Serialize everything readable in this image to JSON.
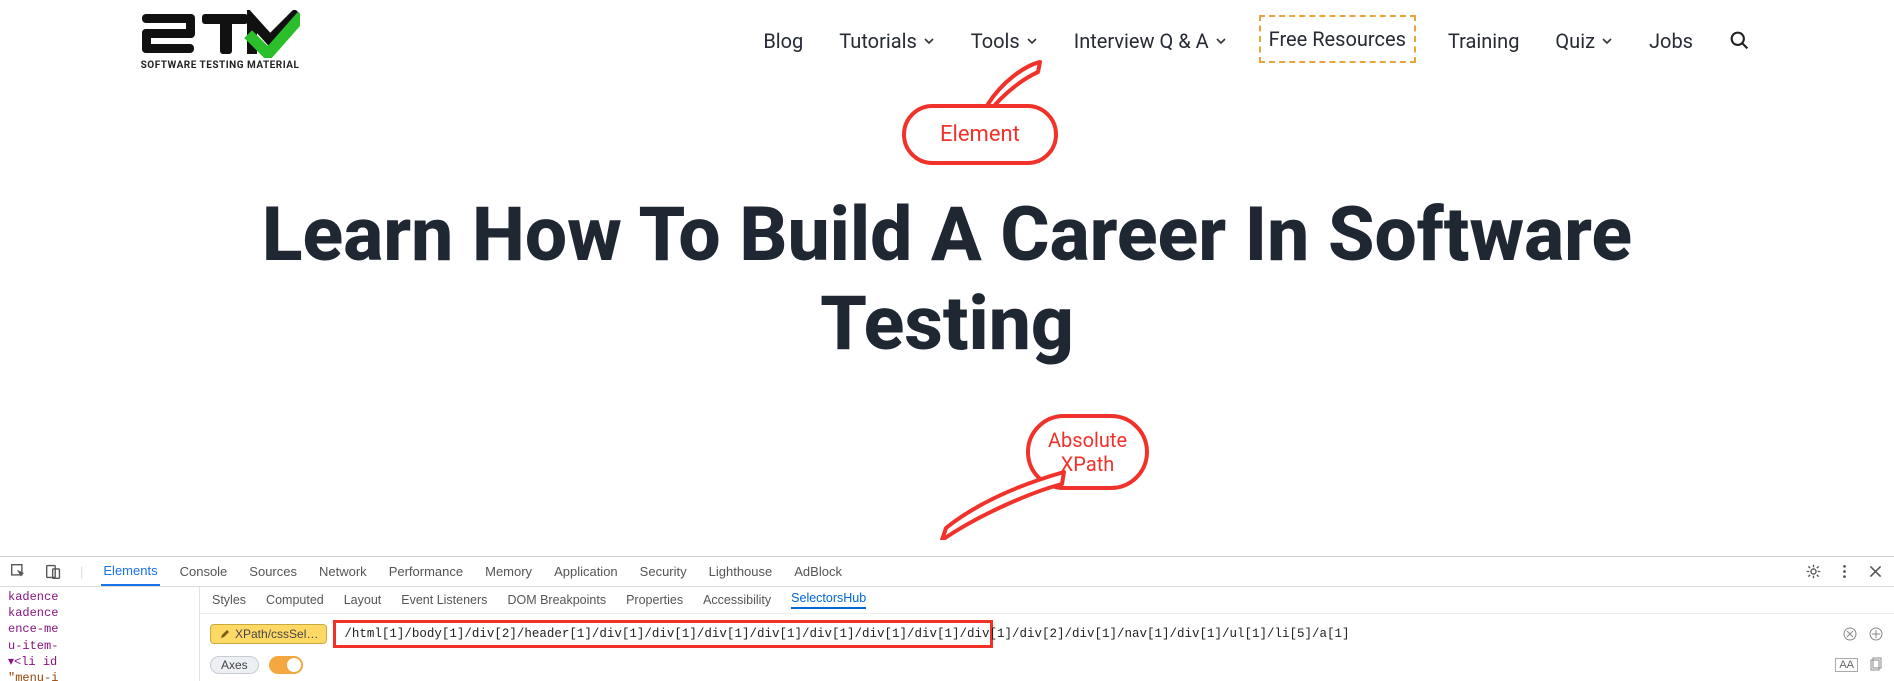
{
  "logo": {
    "text": "ST",
    "subtitle": "SOFTWARE TESTING MATERIAL"
  },
  "nav": {
    "items": [
      {
        "label": "Blog",
        "has_dropdown": false
      },
      {
        "label": "Tutorials",
        "has_dropdown": true
      },
      {
        "label": "Tools",
        "has_dropdown": true
      },
      {
        "label": "Interview Q & A",
        "has_dropdown": true
      },
      {
        "label": "Free Resources",
        "has_dropdown": false,
        "highlighted": true
      },
      {
        "label": "Training",
        "has_dropdown": false
      },
      {
        "label": "Quiz",
        "has_dropdown": true
      },
      {
        "label": "Jobs",
        "has_dropdown": false
      }
    ]
  },
  "hero": {
    "title": "Learn How To Build A Career In Software Testing"
  },
  "annotations": {
    "element_label": "Element",
    "xpath_label_line1": "Absolute",
    "xpath_label_line2": "XPath"
  },
  "devtools": {
    "main_tabs": [
      "Elements",
      "Console",
      "Sources",
      "Network",
      "Performance",
      "Memory",
      "Application",
      "Security",
      "Lighthouse",
      "AdBlock"
    ],
    "main_active": "Elements",
    "side_tabs": [
      "Styles",
      "Computed",
      "Layout",
      "Event Listeners",
      "DOM Breakpoints",
      "Properties",
      "Accessibility",
      "SelectorsHub"
    ],
    "side_active": "SelectorsHub",
    "xpath_badge": "XPath/cssSel…",
    "xpath_value": "/html[1]/body[1]/div[2]/header[1]/div[1]/div[1]/div[1]/div[1]/div[1]/div[1]/div[1]/div[1]/div[2]/div[1]/nav[1]/div[1]/ul[1]/li[5]/a[1]",
    "axes_label": "Axes",
    "dom_snippet": {
      "l1": "kadence",
      "l2": "kadence",
      "l3": "ence-me",
      "l4": "u-item-",
      "l5": "▾<li id",
      "l6": "\"menu-i"
    },
    "aa": "AA"
  }
}
